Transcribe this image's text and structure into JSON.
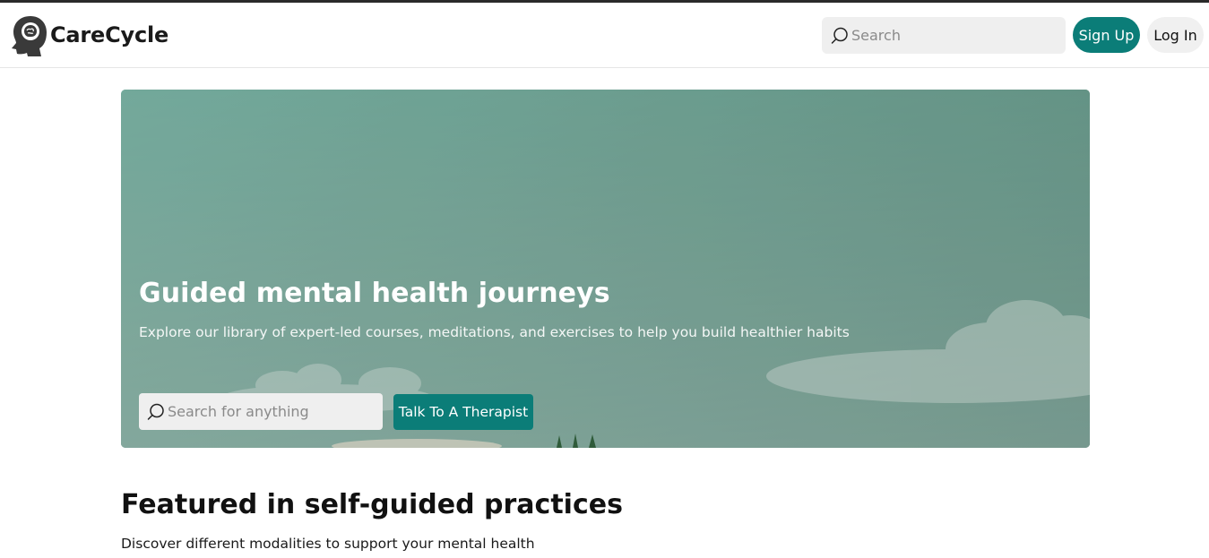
{
  "brand": {
    "name": "CareCycle",
    "logo_icon": "head-brain-icon"
  },
  "nav": {
    "search_placeholder": "Search",
    "search_icon": "search-icon",
    "signup_label": "Sign Up",
    "login_label": "Log In"
  },
  "hero": {
    "title": "Guided mental health journeys",
    "subtitle": "Explore our library of expert-led courses, meditations, and exercises to help you build healthier habits",
    "search_placeholder": "Search for anything",
    "search_icon": "search-icon",
    "cta_label": "Talk To A Therapist"
  },
  "section": {
    "title": "Featured in self-guided practices",
    "subtitle": "Discover different modalities to support your mental health"
  },
  "colors": {
    "accent": "#0b7d78",
    "hero_top": "#7db7a8",
    "hero_bottom": "#4f7a6f",
    "input_bg": "#efefef"
  }
}
